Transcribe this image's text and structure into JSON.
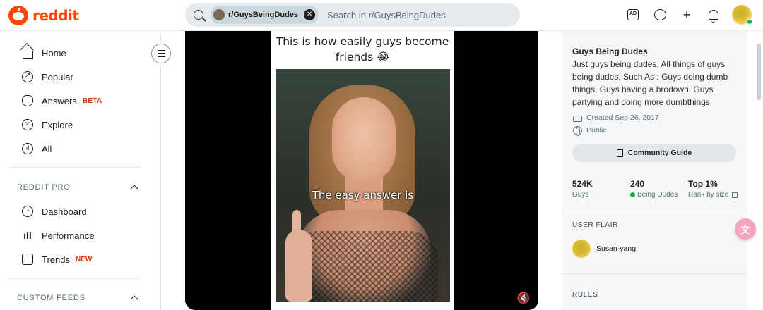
{
  "brand": {
    "name": "reddit"
  },
  "search": {
    "chip_label": "r/GuysBeingDudes",
    "placeholder": "Search in r/GuysBeingDudes"
  },
  "sidebar": {
    "nav": [
      {
        "label": "Home",
        "icon": "home-icon"
      },
      {
        "label": "Popular",
        "icon": "popular-icon"
      },
      {
        "label": "Answers",
        "icon": "answers-icon",
        "badge": "BETA"
      },
      {
        "label": "Explore",
        "icon": "explore-icon"
      },
      {
        "label": "All",
        "icon": "all-icon"
      }
    ],
    "reddit_pro": {
      "heading": "REDDIT PRO",
      "items": [
        {
          "label": "Dashboard",
          "icon": "dashboard-icon"
        },
        {
          "label": "Performance",
          "icon": "performance-icon"
        },
        {
          "label": "Trends",
          "icon": "trends-icon",
          "badge": "NEW"
        }
      ]
    },
    "custom_feeds": {
      "heading": "CUSTOM FEEDS"
    }
  },
  "post": {
    "video_caption": "This is how easily guys become friends 😂",
    "subtitle": "The easy answer is"
  },
  "community": {
    "name": "Guys Being Dudes",
    "description": "Just guys being dudes. All things of guys being dudes, Such As : Guys doing dumb things, Guys having a brodown, Guys partying and doing more dumbthings",
    "created": "Created Sep 26, 2017",
    "visibility": "Public",
    "guide_button": "Community Guide",
    "stats": [
      {
        "value": "524K",
        "label": "Guys"
      },
      {
        "value": "240",
        "label": "Being Dudes"
      },
      {
        "value": "Top 1%",
        "label": "Rank by size"
      }
    ],
    "user_flair_heading": "USER FLAIR",
    "flair_username": "Susan-yang",
    "rules_heading": "RULES"
  },
  "colors": {
    "brand": "#ff4500",
    "online": "#0eb34a",
    "badge": "#d93900"
  }
}
